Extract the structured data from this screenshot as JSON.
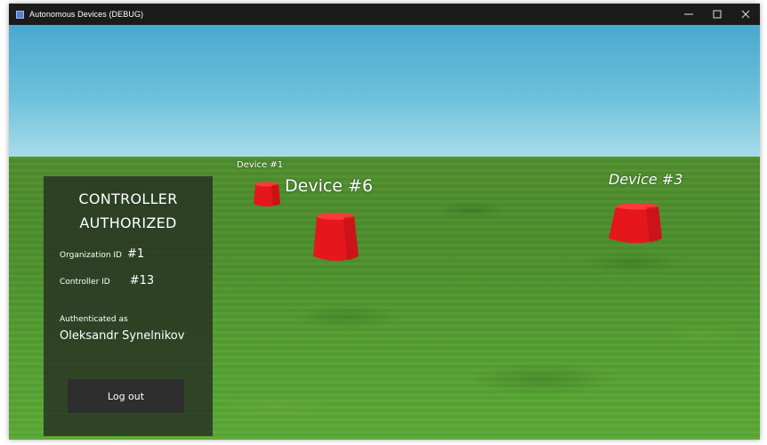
{
  "window": {
    "title": "Autonomous Devices (DEBUG)",
    "controls": [
      "minimize-icon",
      "maximize-icon",
      "close-icon"
    ]
  },
  "scene": {
    "sky_color": "#5fb6d6",
    "ground_color": "#4f942f",
    "device_color": "#e8161b",
    "devices": [
      {
        "label": "Device #1"
      },
      {
        "label": "Device #6"
      },
      {
        "label": "Device #3"
      }
    ]
  },
  "panel": {
    "title_line1": "CONTROLLER",
    "title_line2": "AUTHORIZED",
    "organization_label": "Organization ID",
    "organization_value": "#1",
    "controller_label": "Controller ID",
    "controller_value": "#13",
    "authenticated_label": "Authenticated as",
    "authenticated_name": "Oleksandr Synelnikov",
    "logout_label": "Log out"
  }
}
